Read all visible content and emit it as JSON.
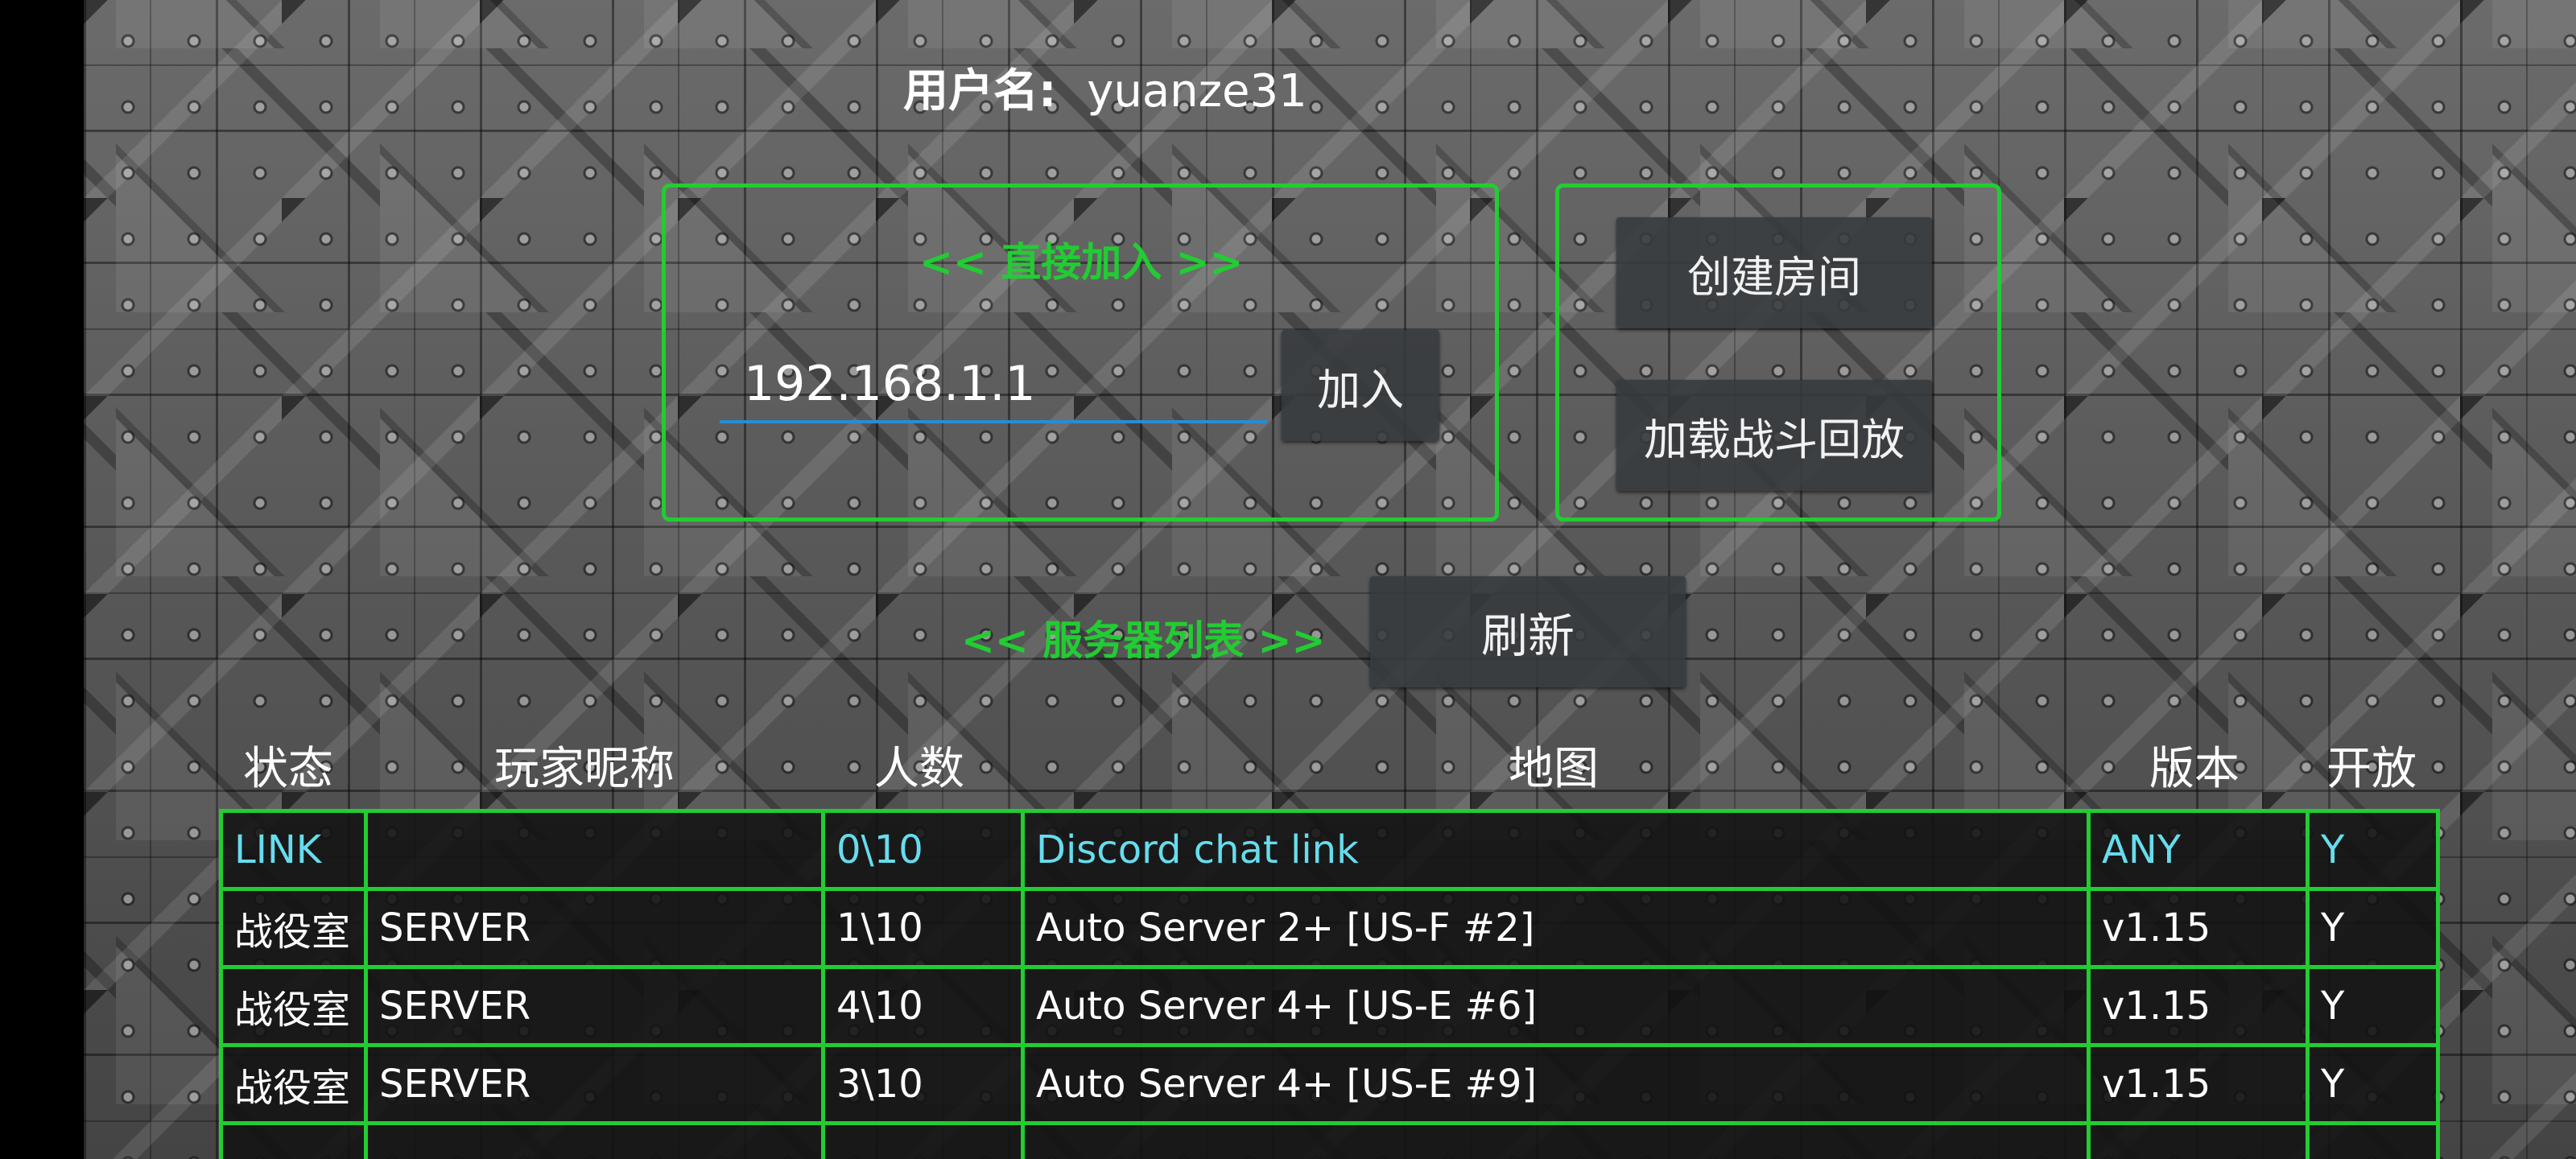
{
  "user": {
    "label": "用户名:",
    "name": "yuanze31"
  },
  "direct_join": {
    "heading": "<< 直接加入 >>",
    "ip_value": "192.168.1.1",
    "join_label": "加入"
  },
  "room": {
    "create_label": "创建房间",
    "replay_label": "加载战斗回放"
  },
  "server_list": {
    "heading": "<< 服务器列表 >>",
    "refresh_label": "刷新",
    "columns": [
      "状态",
      "玩家昵称",
      "人数",
      "地图",
      "版本",
      "开放"
    ],
    "rows": [
      {
        "status": "LINK",
        "player": "",
        "count": "0\\10",
        "map": "Discord chat link",
        "version": "ANY",
        "open": "Y"
      },
      {
        "status": "战役室",
        "player": "SERVER",
        "count": "1\\10",
        "map": "Auto Server 2+ [US-F #2]",
        "version": "v1.15",
        "open": "Y"
      },
      {
        "status": "战役室",
        "player": "SERVER",
        "count": "4\\10",
        "map": "Auto Server 4+ [US-E #6]",
        "version": "v1.15",
        "open": "Y"
      },
      {
        "status": "战役室",
        "player": "SERVER",
        "count": "3\\10",
        "map": "Auto Server 4+ [US-E #9]",
        "version": "v1.15",
        "open": "Y"
      }
    ]
  },
  "colors": {
    "accent": "#22cc33",
    "link_text": "#66ddee",
    "input_underline": "#2a8cd0"
  }
}
